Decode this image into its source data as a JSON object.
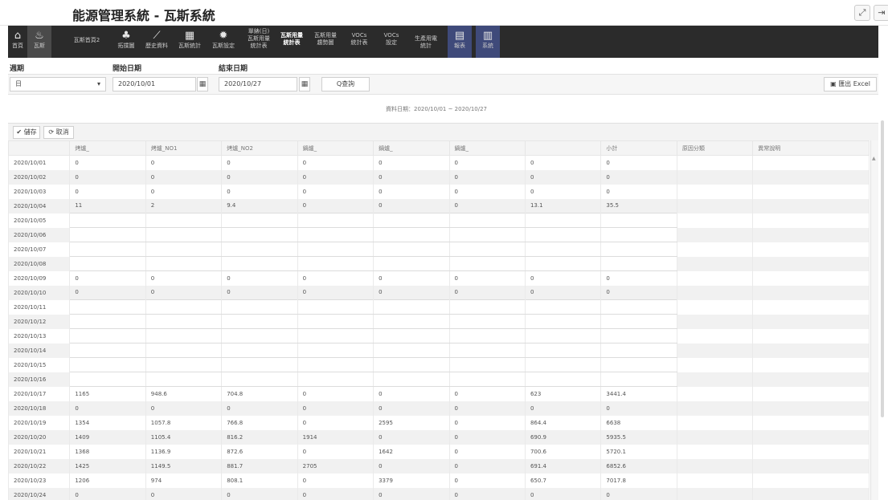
{
  "app": {
    "title": "能源管理系統 - 瓦斯系統"
  },
  "window_buttons": [
    {
      "icon": "expand-icon",
      "glyph": "⤢"
    },
    {
      "icon": "logout-icon",
      "glyph": "⇥"
    }
  ],
  "nav": [
    {
      "glyph": "⌂",
      "label": "首頁",
      "icon": "home-icon"
    },
    {
      "glyph": "♨",
      "label": "瓦斯",
      "icon": "gas-flame-icon",
      "active": true
    },
    {
      "glyph": "",
      "label": "瓦斯首頁2"
    },
    {
      "glyph": "♣",
      "label": "拓撲圖",
      "icon": "topology-icon"
    },
    {
      "glyph": "⟋",
      "label": "歷史資料",
      "icon": "history-chart-icon"
    },
    {
      "glyph": "▦",
      "label": "瓦斯統計",
      "icon": "calculator-icon"
    },
    {
      "glyph": "✹",
      "label": "瓦斯設定",
      "icon": "settings-icon"
    },
    {
      "glyph": "",
      "label": "單錶(日)\n瓦斯用量\n統計表"
    },
    {
      "glyph": "",
      "label": "瓦斯用量\n統計表",
      "bold": true
    },
    {
      "glyph": "",
      "label": "瓦斯用量\n趨勢圖"
    },
    {
      "glyph": "",
      "label": "VOCs\n統計表"
    },
    {
      "glyph": "",
      "label": "VOCs\n設定"
    },
    {
      "glyph": "",
      "label": "生產用電\n統計"
    },
    {
      "glyph": "▤",
      "label": "報表",
      "icon": "report-icon",
      "blue": true
    },
    {
      "glyph": "▥",
      "label": "系統",
      "icon": "system-icon",
      "blue": true
    }
  ],
  "filters": {
    "period_label": "週期",
    "period_value": "日",
    "period_arrow": "▾",
    "start_label": "開始日期",
    "start_value": "2020/10/01",
    "end_label": "結束日期",
    "end_value": "2020/10/27",
    "calendar_glyph": "▦",
    "query_label": "Q查詢",
    "export_label": "匯出 Excel",
    "export_glyph": "▣"
  },
  "date_range": "資料日期：2020/10/01 ~ 2020/10/27",
  "toolbar": {
    "save_label": "✔ 儲存",
    "cancel_label": "⟳ 取消"
  },
  "table": {
    "columns": [
      "",
      "烤爐_",
      "烤爐_NO1",
      "烤爐_NO2",
      "鍋爐_",
      "鍋爐_",
      "鍋爐_",
      "",
      "小計",
      "原因分類",
      "異常說明"
    ],
    "rows": [
      [
        "2020/10/01",
        "0",
        "0",
        "0",
        "0",
        "0",
        "0",
        "0",
        "0",
        "",
        ""
      ],
      [
        "2020/10/02",
        "0",
        "0",
        "0",
        "0",
        "0",
        "0",
        "0",
        "0",
        "",
        ""
      ],
      [
        "2020/10/03",
        "0",
        "0",
        "0",
        "0",
        "0",
        "0",
        "0",
        "0",
        "",
        ""
      ],
      [
        "2020/10/04",
        "11",
        "2",
        "9.4",
        "0",
        "0",
        "0",
        "13.1",
        "35.5",
        "",
        ""
      ],
      [
        "2020/10/05",
        "",
        "",
        "",
        "",
        "",
        "",
        "",
        "",
        "",
        ""
      ],
      [
        "2020/10/06",
        "",
        "",
        "",
        "",
        "",
        "",
        "",
        "",
        "",
        ""
      ],
      [
        "2020/10/07",
        "",
        "",
        "",
        "",
        "",
        "",
        "",
        "",
        "",
        ""
      ],
      [
        "2020/10/08",
        "",
        "",
        "",
        "",
        "",
        "",
        "",
        "",
        "",
        ""
      ],
      [
        "2020/10/09",
        "0",
        "0",
        "0",
        "0",
        "0",
        "0",
        "0",
        "0",
        "",
        ""
      ],
      [
        "2020/10/10",
        "0",
        "0",
        "0",
        "0",
        "0",
        "0",
        "0",
        "0",
        "",
        ""
      ],
      [
        "2020/10/11",
        "",
        "",
        "",
        "",
        "",
        "",
        "",
        "",
        "",
        ""
      ],
      [
        "2020/10/12",
        "",
        "",
        "",
        "",
        "",
        "",
        "",
        "",
        "",
        ""
      ],
      [
        "2020/10/13",
        "",
        "",
        "",
        "",
        "",
        "",
        "",
        "",
        "",
        ""
      ],
      [
        "2020/10/14",
        "",
        "",
        "",
        "",
        "",
        "",
        "",
        "",
        "",
        ""
      ],
      [
        "2020/10/15",
        "",
        "",
        "",
        "",
        "",
        "",
        "",
        "",
        "",
        ""
      ],
      [
        "2020/10/16",
        "",
        "",
        "",
        "",
        "",
        "",
        "",
        "",
        "",
        ""
      ],
      [
        "2020/10/17",
        "1165",
        "948.6",
        "704.8",
        "0",
        "0",
        "0",
        "623",
        "3441.4",
        "",
        ""
      ],
      [
        "2020/10/18",
        "0",
        "0",
        "0",
        "0",
        "0",
        "0",
        "0",
        "0",
        "",
        ""
      ],
      [
        "2020/10/19",
        "1354",
        "1057.8",
        "766.8",
        "0",
        "2595",
        "0",
        "864.4",
        "6638",
        "",
        ""
      ],
      [
        "2020/10/20",
        "1409",
        "1105.4",
        "816.2",
        "1914",
        "0",
        "0",
        "690.9",
        "5935.5",
        "",
        ""
      ],
      [
        "2020/10/21",
        "1368",
        "1136.9",
        "872.6",
        "0",
        "1642",
        "0",
        "700.6",
        "5720.1",
        "",
        ""
      ],
      [
        "2020/10/22",
        "1425",
        "1149.5",
        "881.7",
        "2705",
        "0",
        "0",
        "691.4",
        "6852.6",
        "",
        ""
      ],
      [
        "2020/10/23",
        "1206",
        "974",
        "808.1",
        "0",
        "3379",
        "0",
        "650.7",
        "7017.8",
        "",
        ""
      ],
      [
        "2020/10/24",
        "0",
        "0",
        "0",
        "0",
        "0",
        "0",
        "0",
        "0",
        "",
        ""
      ]
    ]
  }
}
